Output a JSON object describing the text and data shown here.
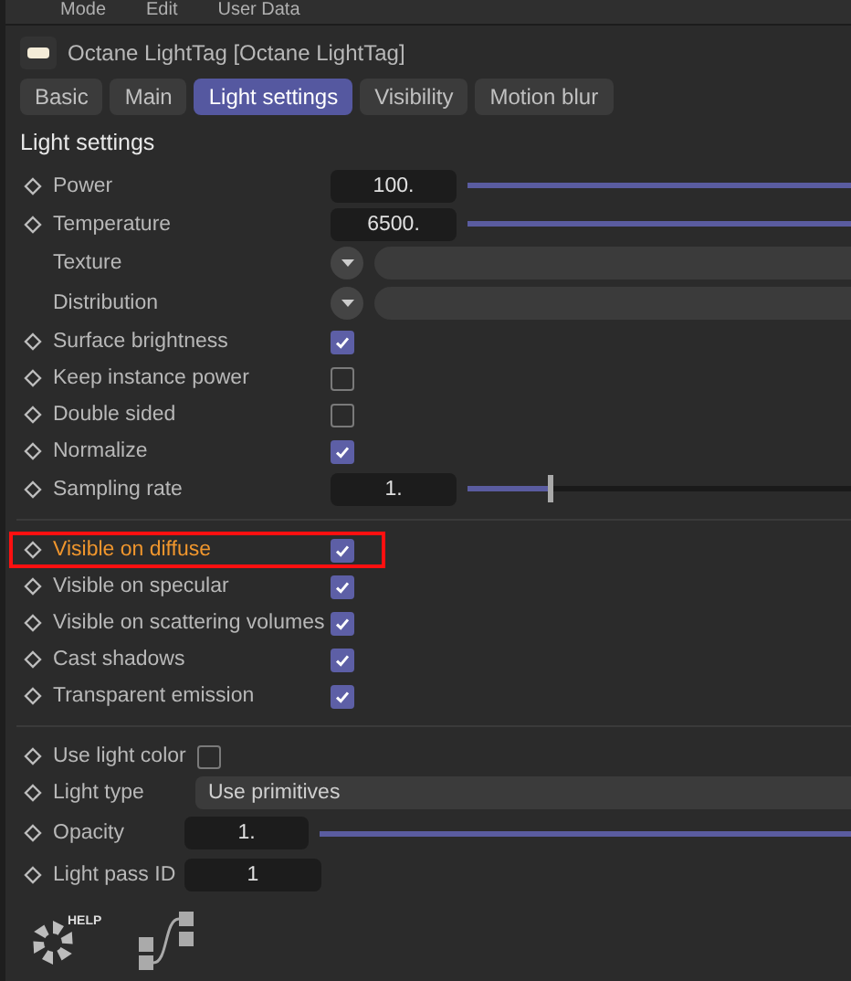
{
  "menu": [
    "Mode",
    "Edit",
    "User Data"
  ],
  "header": {
    "title": "Octane LightTag [Octane LightTag]"
  },
  "tabs": [
    {
      "label": "Basic",
      "selected": false
    },
    {
      "label": "Main",
      "selected": false
    },
    {
      "label": "Light settings",
      "selected": true
    },
    {
      "label": "Visibility",
      "selected": false
    },
    {
      "label": "Motion blur",
      "selected": false
    }
  ],
  "section_title": "Light settings",
  "groups": [
    {
      "rows": [
        {
          "kind": "slider",
          "label": "Power",
          "animatable": true,
          "value": "100.",
          "level": 1
        },
        {
          "kind": "slider",
          "label": "Temperature",
          "animatable": true,
          "value": "6500.",
          "level": 1
        },
        {
          "kind": "link",
          "label": "Texture",
          "animatable": false
        },
        {
          "kind": "link",
          "label": "Distribution",
          "animatable": false
        },
        {
          "kind": "checkbox",
          "label": "Surface brightness",
          "animatable": true,
          "checked": true
        },
        {
          "kind": "checkbox",
          "label": "Keep instance power",
          "animatable": true,
          "checked": false
        },
        {
          "kind": "checkbox",
          "label": "Double sided",
          "animatable": true,
          "checked": false
        },
        {
          "kind": "checkbox",
          "label": "Normalize",
          "animatable": true,
          "checked": true
        },
        {
          "kind": "slider",
          "label": "Sampling rate",
          "animatable": true,
          "value": "1.",
          "level": 0.2
        }
      ]
    },
    {
      "rows": [
        {
          "kind": "checkbox",
          "label": "Visible on diffuse",
          "animatable": true,
          "checked": true,
          "highlighted": true
        },
        {
          "kind": "checkbox",
          "label": "Visible on specular",
          "animatable": true,
          "checked": true,
          "highlighted": false
        },
        {
          "kind": "checkbox",
          "label": "Visible on scattering volumes",
          "animatable": true,
          "checked": true,
          "highlighted": false
        },
        {
          "kind": "checkbox",
          "label": "Cast shadows",
          "animatable": true,
          "checked": true,
          "highlighted": false
        },
        {
          "kind": "checkbox",
          "label": "Transparent emission",
          "animatable": true,
          "checked": true,
          "highlighted": false
        }
      ]
    },
    {
      "rows": [
        {
          "kind": "checkbox",
          "label": "Use light color",
          "animatable": true,
          "checked": false
        },
        {
          "kind": "select",
          "label": "Light type",
          "animatable": true,
          "value": "Use primitives"
        },
        {
          "kind": "slider",
          "label": "Opacity",
          "animatable": true,
          "value": "1.",
          "level": 1
        },
        {
          "kind": "number",
          "label": "Light pass ID",
          "animatable": true,
          "value": "1"
        }
      ]
    }
  ],
  "footer": {
    "help_label": "HELP"
  }
}
